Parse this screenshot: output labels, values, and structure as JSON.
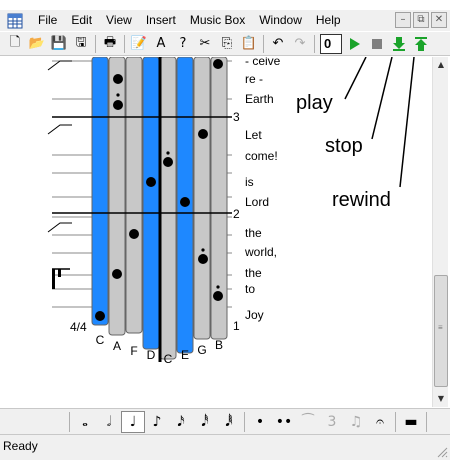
{
  "menubar": {
    "items": [
      "File",
      "Edit",
      "View",
      "Insert",
      "Music Box",
      "Window",
      "Help"
    ],
    "window_buttons": [
      "–",
      "⧉",
      "✕"
    ]
  },
  "toolbar": {
    "buttons": [
      {
        "name": "new-document-icon",
        "glyph": "🗋"
      },
      {
        "name": "open-folder-icon",
        "glyph": "📂"
      },
      {
        "name": "save-icon",
        "glyph": "💾"
      },
      {
        "name": "save-as-icon",
        "glyph": "🖫"
      },
      {
        "name": "print-icon",
        "glyph": "🖶"
      },
      {
        "name": "edit-text-icon",
        "glyph": "📝"
      },
      {
        "name": "text-style-icon",
        "glyph": "A"
      },
      {
        "name": "help-icon",
        "glyph": "?"
      },
      {
        "name": "cut-icon",
        "glyph": "✂"
      },
      {
        "name": "copy-icon",
        "glyph": "⎘"
      },
      {
        "name": "paste-icon",
        "glyph": "📋"
      },
      {
        "name": "undo-icon",
        "glyph": "↶"
      },
      {
        "name": "redo-icon",
        "glyph": "↷"
      }
    ],
    "bar_number": "0",
    "play_color": "#1aa32a",
    "stop_color": "#808080",
    "rewind_color": "#1aa32a"
  },
  "score": {
    "tines": [
      "C",
      "A",
      "F",
      "D",
      "C",
      "E",
      "G",
      "B"
    ],
    "tine_colors": {
      "white": "#c8c8c8",
      "blue": "#1e88ff"
    },
    "time_signature": "4/4",
    "bar_numbers": [
      "3",
      "2",
      "1"
    ],
    "lyrics": [
      "- ceive",
      "re -",
      "Earth",
      "Let",
      "come!",
      "is",
      "Lord",
      "the",
      "world,",
      "the",
      "to",
      "Joy"
    ]
  },
  "annotations": {
    "play": "play",
    "stop": "stop",
    "rewind": "rewind"
  },
  "durations": [
    {
      "name": "whole-note-icon",
      "glyph": "𝅝"
    },
    {
      "name": "half-note-icon",
      "glyph": "𝅗𝅥"
    },
    {
      "name": "quarter-note-icon",
      "glyph": "♩"
    },
    {
      "name": "eighth-note-icon",
      "glyph": "♪"
    },
    {
      "name": "sixteenth-note-icon",
      "glyph": "𝅘𝅥𝅯"
    },
    {
      "name": "thirty-second-note-icon",
      "glyph": "𝅘𝅥𝅰"
    },
    {
      "name": "sixty-fourth-note-icon",
      "glyph": "𝅘𝅥𝅱"
    },
    {
      "name": "dot-icon",
      "glyph": "•"
    },
    {
      "name": "double-dot-icon",
      "glyph": "••"
    },
    {
      "name": "tie-icon",
      "glyph": "⁀"
    },
    {
      "name": "triplet-icon",
      "glyph": "3"
    },
    {
      "name": "beam-icon",
      "glyph": "♫"
    },
    {
      "name": "fermata-icon",
      "glyph": "𝄐"
    },
    {
      "name": "rest-icon",
      "glyph": "▬"
    }
  ],
  "status": {
    "text": "Ready"
  }
}
